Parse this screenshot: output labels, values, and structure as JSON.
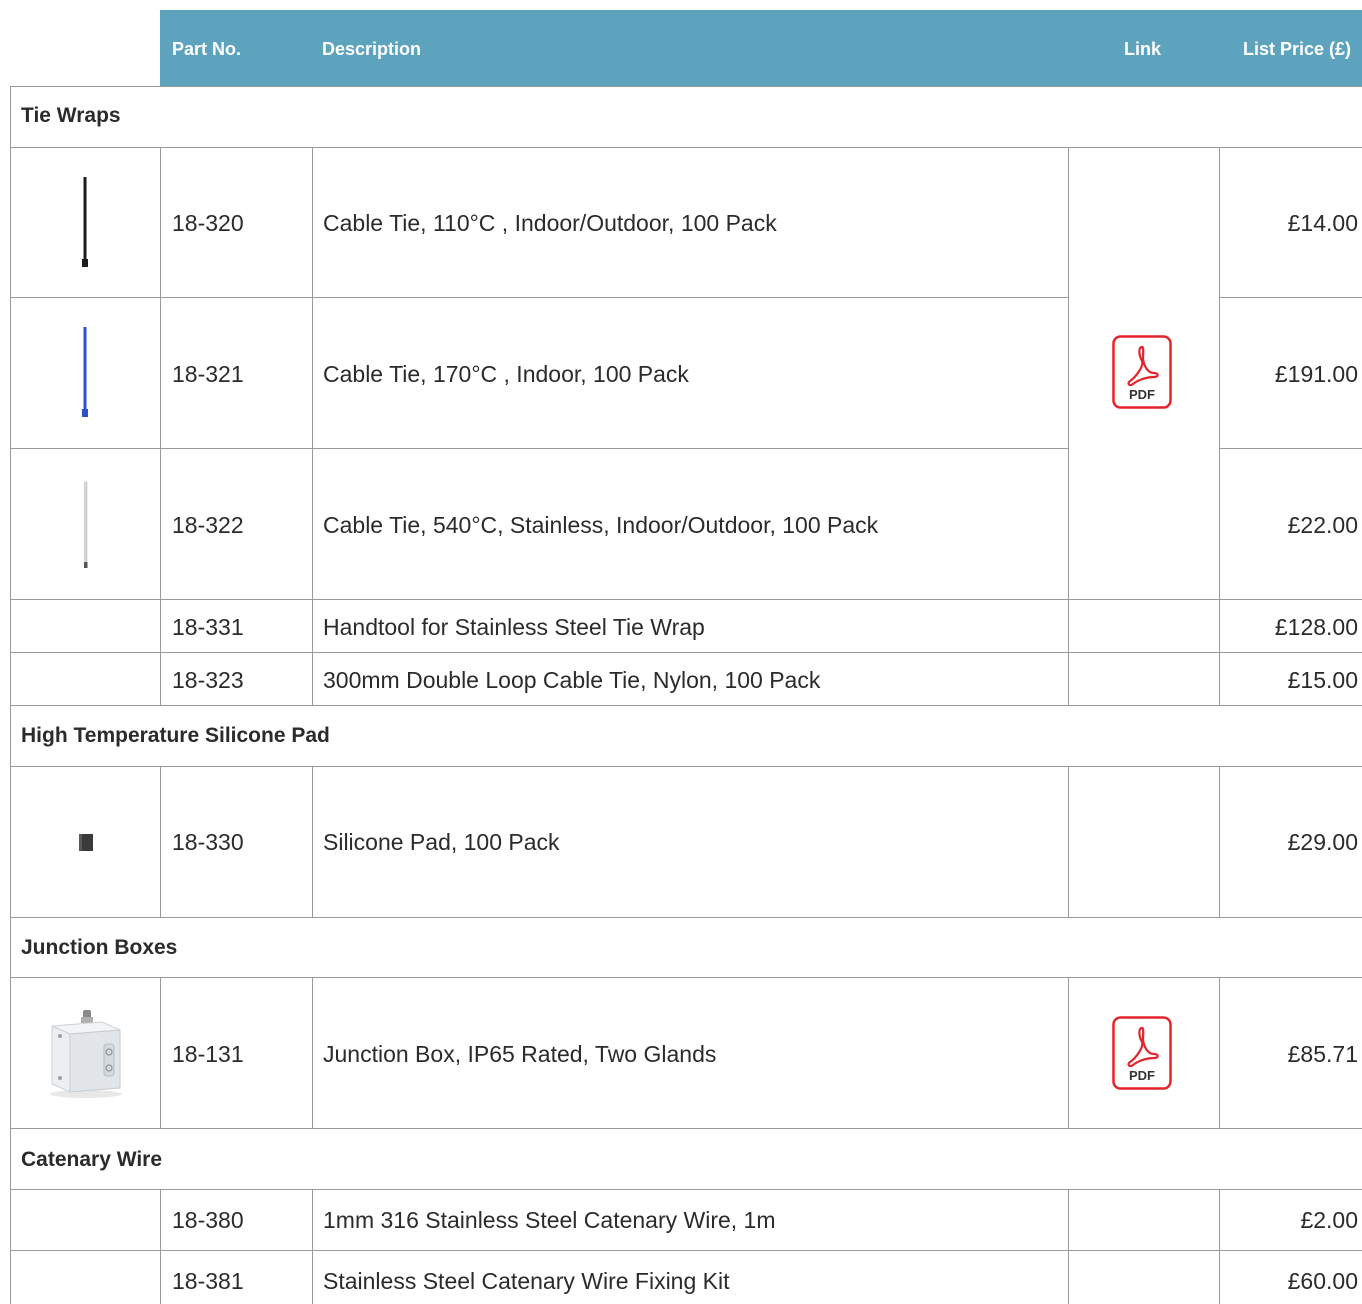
{
  "header": {
    "part_no": "Part No.",
    "description": "Description",
    "link": "Link",
    "list_price": "List Price (£)"
  },
  "colors": {
    "header_bg": "#5ea3bd",
    "pdf_red": "#e3242b",
    "border": "#9a9a9a"
  },
  "categories": [
    {
      "name": "Tie Wraps"
    },
    {
      "name": "High Temperature Silicone Pad"
    },
    {
      "name": "Junction Boxes"
    },
    {
      "name": "Catenary Wire"
    }
  ],
  "products": [
    {
      "part_no": "18-320",
      "description": "Cable Tie, 110°C , Indoor/Outdoor, 100 Pack",
      "price": "£14.00",
      "thumbnail": "black-cable-tie"
    },
    {
      "part_no": "18-321",
      "description": "Cable Tie, 170°C , Indoor, 100 Pack",
      "price": "£191.00",
      "thumbnail": "blue-cable-tie"
    },
    {
      "part_no": "18-322",
      "description": "Cable Tie, 540°C, Stainless, Indoor/Outdoor, 100 Pack",
      "price": "£22.00",
      "thumbnail": "stainless-cable-tie"
    },
    {
      "part_no": "18-331",
      "description": "Handtool for Stainless Steel Tie Wrap",
      "price": "£128.00"
    },
    {
      "part_no": "18-323",
      "description": "300mm Double Loop Cable Tie, Nylon, 100 Pack",
      "price": "£15.00"
    },
    {
      "part_no": "18-330",
      "description": "Silicone Pad, 100 Pack",
      "price": "£29.00",
      "thumbnail": "silicone-pad"
    },
    {
      "part_no": "18-131",
      "description": "Junction Box, IP65 Rated, Two Glands",
      "price": "£85.71",
      "thumbnail": "junction-box"
    },
    {
      "part_no": "18-380",
      "description": "1mm 316 Stainless Steel Catenary Wire, 1m",
      "price": "£2.00"
    },
    {
      "part_no": "18-381",
      "description": "Stainless Steel Catenary Wire Fixing Kit",
      "price": "£60.00"
    }
  ],
  "pdf_icon": {
    "label": "PDF",
    "icon": "pdf-document-icon"
  }
}
